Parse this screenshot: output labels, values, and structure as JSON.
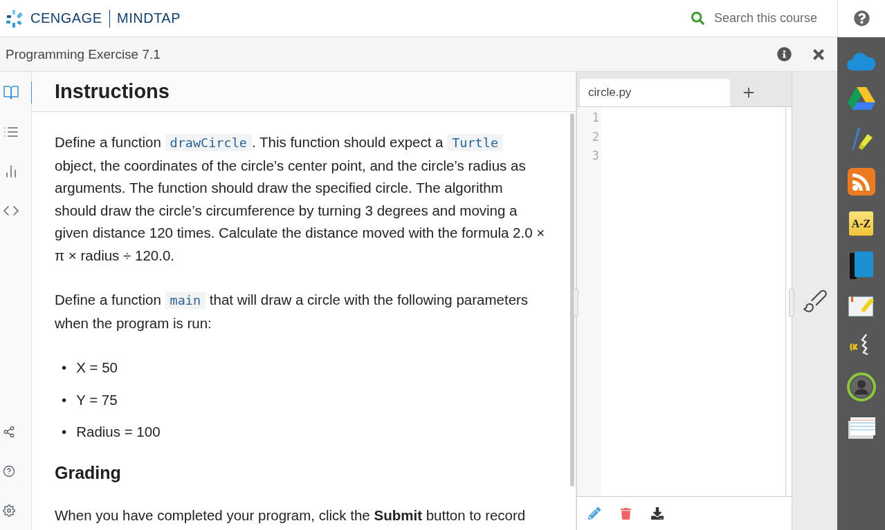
{
  "header": {
    "brand": "CENGAGE",
    "product": "MINDTAP",
    "search": {
      "placeholder": "Search this course"
    }
  },
  "activity_bar": {
    "title": "Programming Exercise 7.1"
  },
  "sidebar": {
    "items": [
      {
        "selected": true
      },
      {
        "selected": false
      },
      {
        "selected": false
      },
      {
        "selected": false
      }
    ],
    "bottom_items": [
      {
        "selected": false
      },
      {
        "selected": false
      },
      {
        "selected": false
      }
    ]
  },
  "instructions": {
    "heading": "Instructions",
    "blocks": [
      {
        "kind": "paragraph",
        "segments": [
          {
            "kind": "text",
            "text": "Define a function "
          },
          {
            "kind": "code",
            "text": "drawCircle"
          },
          {
            "kind": "text",
            "text": ". This function should expect a "
          },
          {
            "kind": "code",
            "text": "Turtle"
          },
          {
            "kind": "text",
            "text": " object, the coordinates of the circle’s center point, and the circle’s radius as arguments. The function should draw the specified circle. The algorithm should draw the circle’s circumference by turning 3 degrees and moving a given distance 120 times. Calculate the distance moved with the formula 2.0 × π × radius ÷ 120.0."
          }
        ]
      },
      {
        "kind": "paragraph",
        "segments": [
          {
            "kind": "text",
            "text": "Define a function "
          },
          {
            "kind": "code",
            "text": "main"
          },
          {
            "kind": "text",
            "text": " that will draw a circle with the following parameters when the program is run:"
          }
        ]
      },
      {
        "kind": "list",
        "items": [
          {
            "bullet": "•",
            "text": "X = 50"
          },
          {
            "bullet": "•",
            "text": "Y = 75"
          },
          {
            "bullet": "•",
            "text": "Radius = 100"
          }
        ]
      },
      {
        "kind": "heading",
        "text": "Grading"
      },
      {
        "kind": "paragraph",
        "segments": [
          {
            "kind": "text",
            "text": "When you have completed your program, click the "
          },
          {
            "kind": "bold",
            "text": "Submit"
          },
          {
            "kind": "text",
            "text": " button to record"
          }
        ]
      }
    ]
  },
  "editor": {
    "tabs": [
      {
        "label": "circle.py",
        "selected": true
      }
    ],
    "line_numbers": [
      "1",
      "2",
      "3"
    ]
  },
  "tools_rail": {
    "glossary_label": "A-Z"
  }
}
